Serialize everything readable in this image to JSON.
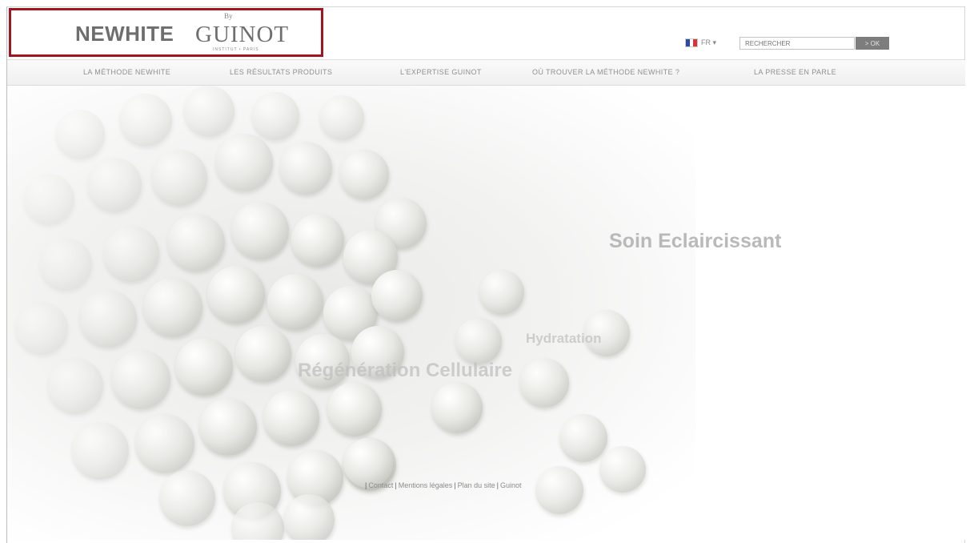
{
  "header": {
    "logo_main": "NEWHITE",
    "logo_brand": "GUINOT",
    "logo_by": "By",
    "logo_tagline": "INSTITUT • PARIS",
    "highlight_color": "#a3161f",
    "language": "FR ▾",
    "search_placeholder": "RECHERCHER",
    "search_button": "> OK"
  },
  "nav": {
    "items": [
      {
        "label": "LA MÉTHODE NEWHITE"
      },
      {
        "label": "LES RÉSULTATS PRODUITS"
      },
      {
        "label": "L'EXPERTISE GUINOT"
      },
      {
        "label": "OÙ TROUVER LA MÉTHODE NEWHITE ?"
      },
      {
        "label": "LA PRESSE EN PARLE"
      }
    ]
  },
  "hero": {
    "headline_main": "Soin Eclaircissant",
    "headline_secondary": "Régénération Cellulaire",
    "headline_tertiary": "Hydratation"
  },
  "footer": {
    "links": [
      {
        "label": "Contact"
      },
      {
        "label": "Mentions légales"
      },
      {
        "label": "Plan du site"
      },
      {
        "label": "Guinot"
      }
    ]
  }
}
